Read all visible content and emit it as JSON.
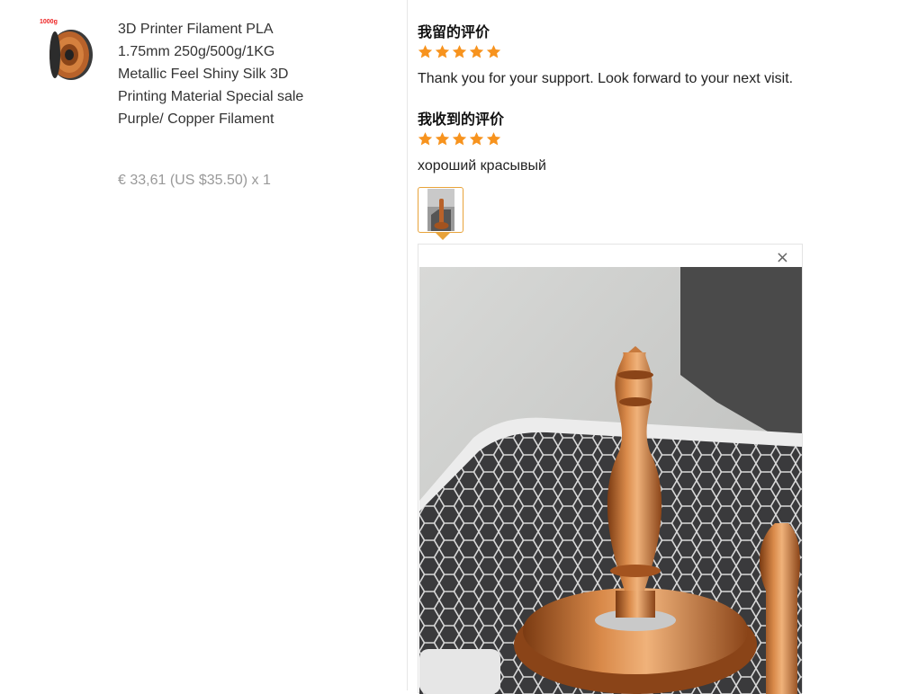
{
  "product": {
    "thumbnail_tag": "1000g",
    "title": "3D Printer Filament PLA 1.75mm 250g/500g/1KG Metallic Feel Shiny Silk 3D Printing Material Special sale Purple/ Copper Filament",
    "price": "€ 33,61 (US $35.50) x 1"
  },
  "reviews": {
    "my_review": {
      "heading": "我留的评价",
      "rating": 5,
      "text": "Thank you for your support. Look forward to your next visit."
    },
    "received_review": {
      "heading": "我收到的评价",
      "rating": 5,
      "text": "хороший красывый"
    }
  },
  "viewer": {
    "close_symbol": "×"
  },
  "colors": {
    "star": "#f7931e",
    "accent_border": "#e8a33a",
    "copper": "#b8622a"
  }
}
